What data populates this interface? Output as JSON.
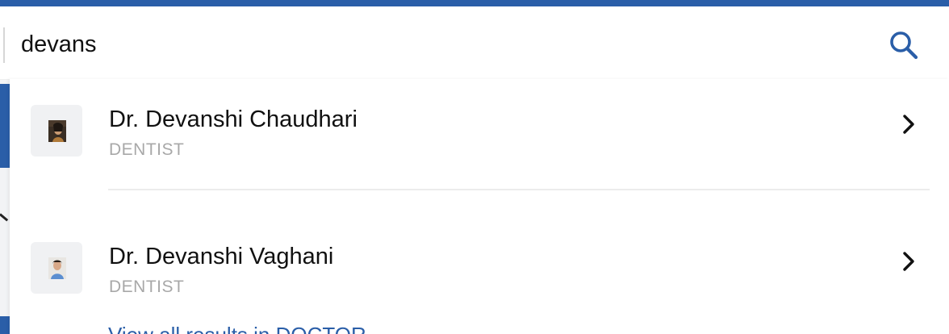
{
  "search": {
    "value": "devans",
    "icon": "search-icon"
  },
  "results": [
    {
      "name": "Dr. Devanshi Chaudhari",
      "specialty": "DENTIST"
    },
    {
      "name": "Dr. Devanshi Vaghani",
      "specialty": "DENTIST"
    }
  ],
  "view_all": "View all results in DOCTOR",
  "colors": {
    "accent": "#2a5ea8",
    "muted_text": "#a8a8a8",
    "avatar_bg": "#f0f1f3"
  }
}
